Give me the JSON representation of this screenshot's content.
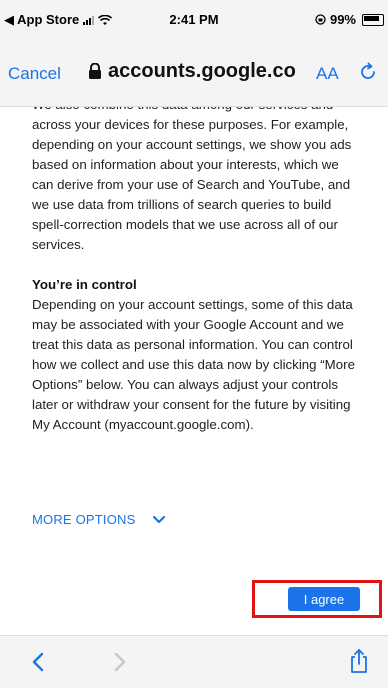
{
  "status_bar": {
    "back_label": "◀ App Store",
    "time": "2:41 PM",
    "battery_percent": "99%"
  },
  "nav": {
    "cancel_label": "Cancel",
    "url": "accounts.google.co",
    "text_size_label": "AA"
  },
  "content": {
    "paragraph_intro": "We also combine this data among our services and across your devices for these purposes. For example, depending on your account settings, we show you ads based on information about your interests, which we can derive from your use of Search and YouTube, and we use data from trillions of search queries to build spell-correction models that we use across all of our services.",
    "control_heading": "You’re in control",
    "control_paragraph": "Depending on your account settings, some of this data may be associated with your Google Account and we treat this data as personal information. You can control how we collect and use this data now by clicking “More Options” below. You can always adjust your controls later or withdraw your consent for the future by visiting My Account (myaccount.google.com).",
    "more_options_label": "MORE OPTIONS",
    "agree_label": "I agree"
  },
  "colors": {
    "link_blue": "#1a73e8",
    "highlight_red": "#e01313"
  },
  "icons": {
    "lock": "lock-icon",
    "reload": "reload-icon",
    "chevron": "chevron-down-icon",
    "back": "back-arrow-icon",
    "forward": "forward-arrow-icon",
    "share": "share-icon"
  }
}
